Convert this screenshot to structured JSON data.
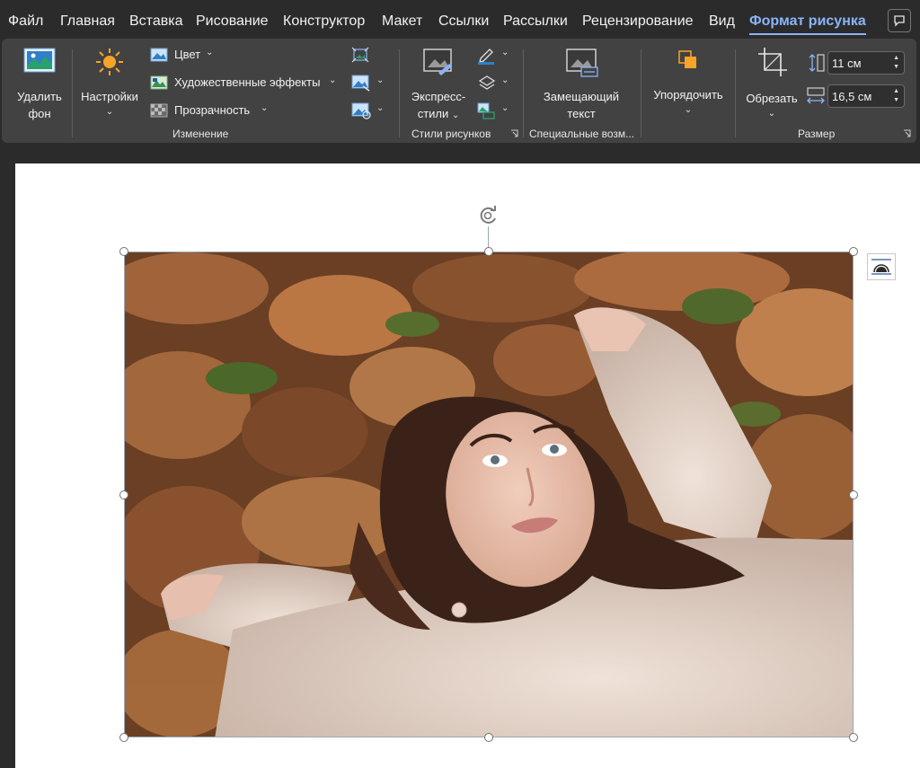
{
  "menu": {
    "tabs": [
      {
        "label": "Файл"
      },
      {
        "label": "Главная"
      },
      {
        "label": "Вставка"
      },
      {
        "label": "Рисование"
      },
      {
        "label": "Конструктор"
      },
      {
        "label": "Макет"
      },
      {
        "label": "Ссылки"
      },
      {
        "label": "Рассылки"
      },
      {
        "label": "Рецензирование"
      },
      {
        "label": "Вид"
      },
      {
        "label": "Формат рисунка"
      }
    ],
    "active_tab": "Формат рисунка"
  },
  "ribbon": {
    "remove_bg": {
      "line1": "Удалить",
      "line2": "фон"
    },
    "corrections": {
      "label": "Настройки"
    },
    "color": {
      "label": "Цвет"
    },
    "artistic": {
      "label": "Художественные эффекты"
    },
    "transparency": {
      "label": "Прозрачность"
    },
    "group_adjust": "Изменение",
    "quick_styles": {
      "line1": "Экспресс-",
      "line2": "стили"
    },
    "group_styles": "Стили рисунков",
    "alt_text": {
      "line1": "Замещающий",
      "line2": "текст"
    },
    "group_accessibility": "Специальные возм...",
    "arrange": {
      "label": "Упорядочить"
    },
    "crop": {
      "label": "Обрезать"
    },
    "height": {
      "value": "11 см"
    },
    "width": {
      "value": "16,5 см"
    },
    "group_size": "Размер"
  },
  "colors": {
    "accent": "#8ab4f8",
    "ribbon_bg": "#424242",
    "app_bg": "#2b2b2b"
  },
  "image": {
    "subject": "woman-lying-in-autumn-leaves-photo"
  }
}
